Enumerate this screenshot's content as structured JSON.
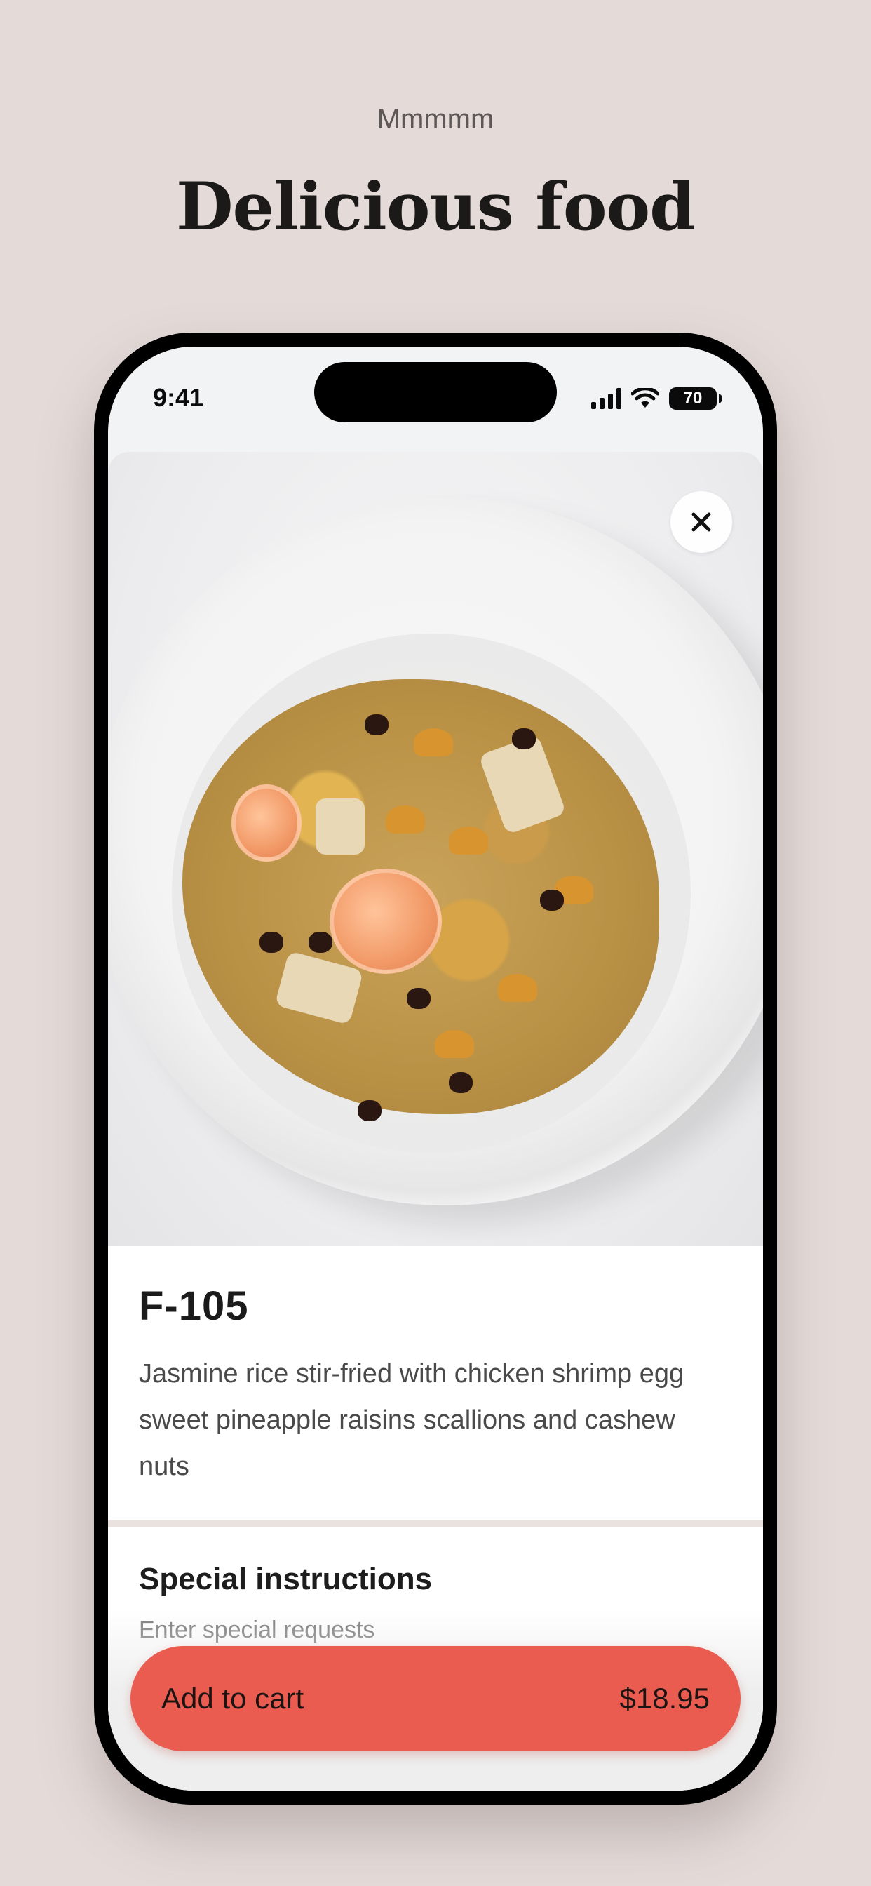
{
  "header": {
    "subtitle": "Mmmmm",
    "title": "Delicious food"
  },
  "status_bar": {
    "time": "9:41",
    "battery": "70"
  },
  "item": {
    "code": "F-105",
    "description": "Jasmine rice stir-fried with chicken shrimp egg sweet pineapple raisins scallions and cashew nuts",
    "image_icon": "fried-rice-plate"
  },
  "special_instructions": {
    "title": "Special instructions",
    "placeholder": "Enter special requests"
  },
  "cart": {
    "label": "Add to cart",
    "price": "$18.95"
  },
  "colors": {
    "background": "#e4dbd9",
    "accent": "#ea5c4f"
  }
}
